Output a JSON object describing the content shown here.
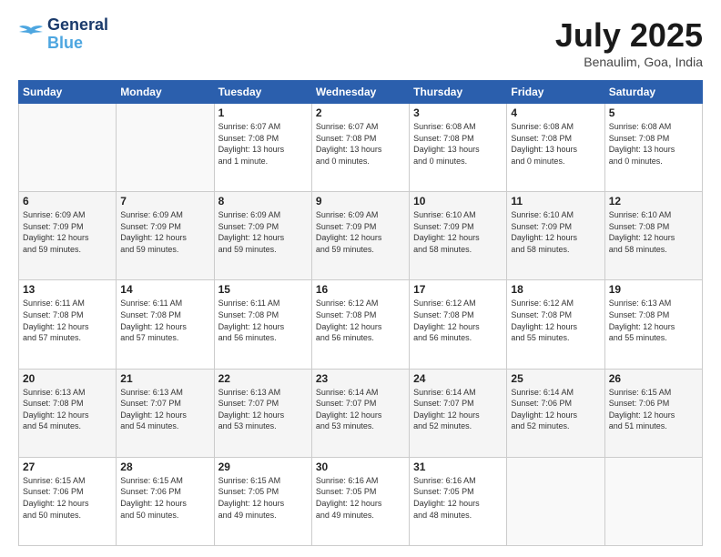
{
  "logo": {
    "line1": "General",
    "line2": "Blue"
  },
  "title": "July 2025",
  "subtitle": "Benaulim, Goa, India",
  "days_of_week": [
    "Sunday",
    "Monday",
    "Tuesday",
    "Wednesday",
    "Thursday",
    "Friday",
    "Saturday"
  ],
  "weeks": [
    [
      {
        "day": "",
        "info": ""
      },
      {
        "day": "",
        "info": ""
      },
      {
        "day": "1",
        "info": "Sunrise: 6:07 AM\nSunset: 7:08 PM\nDaylight: 13 hours\nand 1 minute."
      },
      {
        "day": "2",
        "info": "Sunrise: 6:07 AM\nSunset: 7:08 PM\nDaylight: 13 hours\nand 0 minutes."
      },
      {
        "day": "3",
        "info": "Sunrise: 6:08 AM\nSunset: 7:08 PM\nDaylight: 13 hours\nand 0 minutes."
      },
      {
        "day": "4",
        "info": "Sunrise: 6:08 AM\nSunset: 7:08 PM\nDaylight: 13 hours\nand 0 minutes."
      },
      {
        "day": "5",
        "info": "Sunrise: 6:08 AM\nSunset: 7:08 PM\nDaylight: 13 hours\nand 0 minutes."
      }
    ],
    [
      {
        "day": "6",
        "info": "Sunrise: 6:09 AM\nSunset: 7:09 PM\nDaylight: 12 hours\nand 59 minutes."
      },
      {
        "day": "7",
        "info": "Sunrise: 6:09 AM\nSunset: 7:09 PM\nDaylight: 12 hours\nand 59 minutes."
      },
      {
        "day": "8",
        "info": "Sunrise: 6:09 AM\nSunset: 7:09 PM\nDaylight: 12 hours\nand 59 minutes."
      },
      {
        "day": "9",
        "info": "Sunrise: 6:09 AM\nSunset: 7:09 PM\nDaylight: 12 hours\nand 59 minutes."
      },
      {
        "day": "10",
        "info": "Sunrise: 6:10 AM\nSunset: 7:09 PM\nDaylight: 12 hours\nand 58 minutes."
      },
      {
        "day": "11",
        "info": "Sunrise: 6:10 AM\nSunset: 7:09 PM\nDaylight: 12 hours\nand 58 minutes."
      },
      {
        "day": "12",
        "info": "Sunrise: 6:10 AM\nSunset: 7:08 PM\nDaylight: 12 hours\nand 58 minutes."
      }
    ],
    [
      {
        "day": "13",
        "info": "Sunrise: 6:11 AM\nSunset: 7:08 PM\nDaylight: 12 hours\nand 57 minutes."
      },
      {
        "day": "14",
        "info": "Sunrise: 6:11 AM\nSunset: 7:08 PM\nDaylight: 12 hours\nand 57 minutes."
      },
      {
        "day": "15",
        "info": "Sunrise: 6:11 AM\nSunset: 7:08 PM\nDaylight: 12 hours\nand 56 minutes."
      },
      {
        "day": "16",
        "info": "Sunrise: 6:12 AM\nSunset: 7:08 PM\nDaylight: 12 hours\nand 56 minutes."
      },
      {
        "day": "17",
        "info": "Sunrise: 6:12 AM\nSunset: 7:08 PM\nDaylight: 12 hours\nand 56 minutes."
      },
      {
        "day": "18",
        "info": "Sunrise: 6:12 AM\nSunset: 7:08 PM\nDaylight: 12 hours\nand 55 minutes."
      },
      {
        "day": "19",
        "info": "Sunrise: 6:13 AM\nSunset: 7:08 PM\nDaylight: 12 hours\nand 55 minutes."
      }
    ],
    [
      {
        "day": "20",
        "info": "Sunrise: 6:13 AM\nSunset: 7:08 PM\nDaylight: 12 hours\nand 54 minutes."
      },
      {
        "day": "21",
        "info": "Sunrise: 6:13 AM\nSunset: 7:07 PM\nDaylight: 12 hours\nand 54 minutes."
      },
      {
        "day": "22",
        "info": "Sunrise: 6:13 AM\nSunset: 7:07 PM\nDaylight: 12 hours\nand 53 minutes."
      },
      {
        "day": "23",
        "info": "Sunrise: 6:14 AM\nSunset: 7:07 PM\nDaylight: 12 hours\nand 53 minutes."
      },
      {
        "day": "24",
        "info": "Sunrise: 6:14 AM\nSunset: 7:07 PM\nDaylight: 12 hours\nand 52 minutes."
      },
      {
        "day": "25",
        "info": "Sunrise: 6:14 AM\nSunset: 7:06 PM\nDaylight: 12 hours\nand 52 minutes."
      },
      {
        "day": "26",
        "info": "Sunrise: 6:15 AM\nSunset: 7:06 PM\nDaylight: 12 hours\nand 51 minutes."
      }
    ],
    [
      {
        "day": "27",
        "info": "Sunrise: 6:15 AM\nSunset: 7:06 PM\nDaylight: 12 hours\nand 50 minutes."
      },
      {
        "day": "28",
        "info": "Sunrise: 6:15 AM\nSunset: 7:06 PM\nDaylight: 12 hours\nand 50 minutes."
      },
      {
        "day": "29",
        "info": "Sunrise: 6:15 AM\nSunset: 7:05 PM\nDaylight: 12 hours\nand 49 minutes."
      },
      {
        "day": "30",
        "info": "Sunrise: 6:16 AM\nSunset: 7:05 PM\nDaylight: 12 hours\nand 49 minutes."
      },
      {
        "day": "31",
        "info": "Sunrise: 6:16 AM\nSunset: 7:05 PM\nDaylight: 12 hours\nand 48 minutes."
      },
      {
        "day": "",
        "info": ""
      },
      {
        "day": "",
        "info": ""
      }
    ]
  ]
}
